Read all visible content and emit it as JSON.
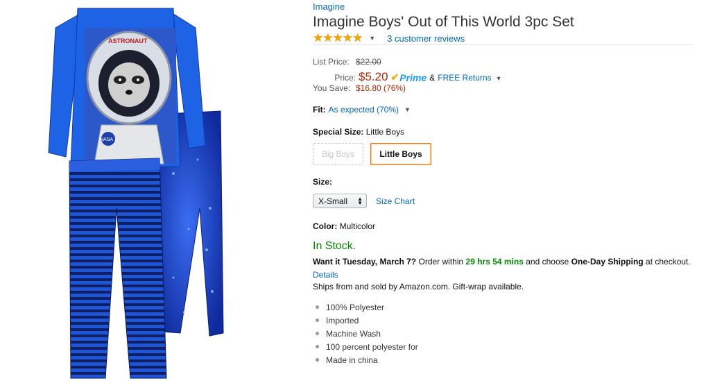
{
  "product": {
    "brand": "Imagine",
    "title": "Imagine Boys' Out of This World 3pc Set",
    "rating_stars": "★★★★★",
    "rating_value": 5,
    "reviews_link": "3 customer reviews"
  },
  "pricing": {
    "list_label": "List Price:",
    "list_value": "$22.00",
    "price_label": "Price:",
    "price_value": "$5.20",
    "prime_label": "Prime",
    "amp": "&",
    "free_returns": "FREE Returns",
    "save_label": "You Save:",
    "save_value": "$16.80 (76%)"
  },
  "fit": {
    "label": "Fit:",
    "value": "As expected (70%)"
  },
  "special_size": {
    "label": "Special Size:",
    "value": "Little Boys",
    "options": [
      {
        "label": "Big Boys",
        "state": "unavailable"
      },
      {
        "label": "Little Boys",
        "state": "selected"
      }
    ]
  },
  "size": {
    "label": "Size:",
    "selected": "X-Small",
    "chart_link": "Size Chart"
  },
  "color": {
    "label": "Color:",
    "value": "Multicolor"
  },
  "availability": {
    "stock": "In Stock.",
    "want_it": "Want it Tuesday, March 7?",
    "order_within": "Order within",
    "countdown": "29 hrs 54 mins",
    "and_choose": "and choose",
    "shipping": "One-Day Shipping",
    "at_checkout": "at checkout.",
    "details_link": "Details",
    "ships_from": "Ships from and sold by Amazon.com. Gift-wrap available."
  },
  "features": [
    "100% Polyester",
    "Imported",
    "Machine Wash",
    "100 percent polyester for",
    "Made in china"
  ],
  "image_text": {
    "helmet": "ASTRONAUT",
    "patch": "NASA"
  },
  "colors": {
    "link": "#0066c0",
    "price": "#b12704",
    "in_stock": "#008a00",
    "selected_border": "#e77600",
    "star": "#f0a500",
    "prime": "#1a98ff"
  }
}
